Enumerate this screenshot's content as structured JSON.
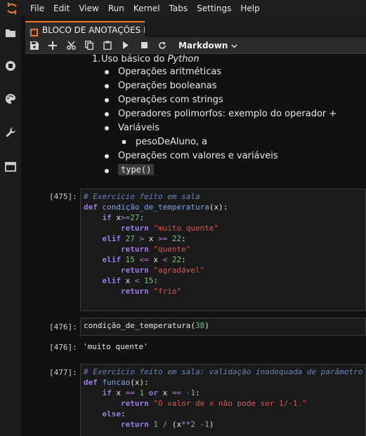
{
  "menu": [
    "File",
    "Edit",
    "View",
    "Run",
    "Kernel",
    "Tabs",
    "Settings",
    "Help"
  ],
  "tab": {
    "label": "BLOCO DE ANOTAÇÕES Mo"
  },
  "toolbar": {
    "cell_type": "Markdown"
  },
  "markdown": {
    "heading_number": "1.",
    "heading_text": "Uso básico do ",
    "heading_em": "Python",
    "items": [
      "Operações aritméticas",
      "Operações booleanas",
      "Operações com strings",
      "Operadores polimorfos: exemplo do operador +",
      "Variáveis"
    ],
    "subitem": "pesoDeAluno, a",
    "items2": [
      "Operações com valores e variáveis"
    ],
    "type_code": "type()"
  },
  "cells": [
    {
      "prompt": "[475]:",
      "lines": [
        [
          [
            "cm",
            "# Exercício feito em sala"
          ]
        ],
        [
          [
            "kw",
            "def "
          ],
          [
            "fn",
            "condição_de_temperatura"
          ],
          [
            "",
            "(x):"
          ]
        ],
        [
          [
            "",
            "    "
          ],
          [
            "kw",
            "if "
          ],
          [
            "",
            "x"
          ],
          [
            "op",
            ">="
          ],
          [
            "num",
            "27"
          ],
          [
            "",
            ":"
          ]
        ],
        [
          [
            "",
            "        "
          ],
          [
            "kw",
            "return "
          ],
          [
            "str",
            "\"muito quente\""
          ]
        ],
        [
          [
            "",
            "    "
          ],
          [
            "kw",
            "elif "
          ],
          [
            "num",
            "27 "
          ],
          [
            "op",
            "> "
          ],
          [
            "",
            "x "
          ],
          [
            "op",
            ">= "
          ],
          [
            "num",
            "22"
          ],
          [
            "",
            ":"
          ]
        ],
        [
          [
            "",
            "        "
          ],
          [
            "kw",
            "return "
          ],
          [
            "str",
            "\"quente\""
          ]
        ],
        [
          [
            "",
            "    "
          ],
          [
            "kw",
            "elif "
          ],
          [
            "num",
            "15 "
          ],
          [
            "op",
            "<= "
          ],
          [
            "",
            "x "
          ],
          [
            "op",
            "< "
          ],
          [
            "num",
            "22"
          ],
          [
            "",
            ":"
          ]
        ],
        [
          [
            "",
            "        "
          ],
          [
            "kw",
            "return "
          ],
          [
            "str",
            "\"agradável\""
          ]
        ],
        [
          [
            "",
            "    "
          ],
          [
            "kw",
            "elif "
          ],
          [
            "",
            "x "
          ],
          [
            "op",
            "< "
          ],
          [
            "num",
            "15"
          ],
          [
            "",
            ":"
          ]
        ],
        [
          [
            "",
            "        "
          ],
          [
            "kw",
            "return "
          ],
          [
            "str",
            "\"frio\""
          ]
        ]
      ]
    },
    {
      "prompt": "[476]:",
      "lines": [
        [
          [
            "",
            "condição_de_temperatura("
          ],
          [
            "num",
            "38"
          ],
          [
            "",
            ")"
          ]
        ]
      ]
    },
    {
      "prompt": "[477]:",
      "lines": [
        [
          [
            "cm",
            "# Exercício feito em sala: validação inadequada de parâmetro"
          ]
        ],
        [
          [
            "kw",
            "def "
          ],
          [
            "fn",
            "funcao"
          ],
          [
            "",
            "(x):"
          ]
        ],
        [
          [
            "",
            "    "
          ],
          [
            "kw",
            "if "
          ],
          [
            "",
            "x "
          ],
          [
            "op",
            "== "
          ],
          [
            "num",
            "1 "
          ],
          [
            "kw",
            "or "
          ],
          [
            "",
            "x "
          ],
          [
            "op",
            "== "
          ],
          [
            "op",
            "-"
          ],
          [
            "num",
            "1"
          ],
          [
            "",
            ":"
          ]
        ],
        [
          [
            "",
            "        "
          ],
          [
            "kw",
            "return "
          ],
          [
            "str",
            "\"O valor de x não pode ser 1/-1.\""
          ]
        ],
        [
          [
            "",
            "    "
          ],
          [
            "kw",
            "else"
          ],
          [
            "",
            ":"
          ]
        ],
        [
          [
            "",
            "        "
          ],
          [
            "kw",
            "return "
          ],
          [
            "num",
            "1 "
          ],
          [
            "op",
            "/ "
          ],
          [
            "",
            "(x"
          ],
          [
            "op",
            "**"
          ],
          [
            "num",
            "2 "
          ],
          [
            "op",
            "-"
          ],
          [
            "num",
            "1"
          ],
          [
            "",
            ")"
          ]
        ]
      ]
    }
  ],
  "output": {
    "prompt": "[476]:",
    "value": "'muito quente'"
  },
  "colors": {
    "accent": "#f37726",
    "keyword": "#9b7bdf",
    "string": "#d25a5a",
    "number": "#7fc27f",
    "comment": "#6a83b8"
  }
}
